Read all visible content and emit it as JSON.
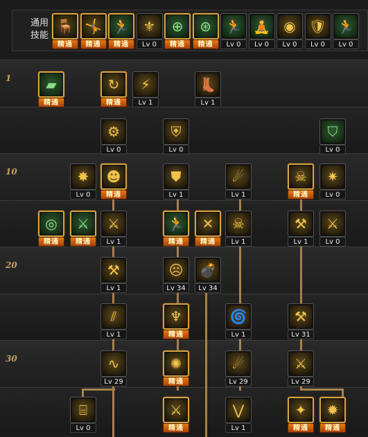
{
  "common": {
    "label": "通用\n技能",
    "skills": [
      {
        "icon": "chair-sit-icon",
        "glyph": "🪑",
        "theme": "yellow",
        "status": "精通"
      },
      {
        "icon": "leap-slash-icon",
        "glyph": "🤸",
        "theme": "yellow",
        "status": "精通"
      },
      {
        "icon": "dash-kick-icon",
        "glyph": "🏃",
        "theme": "green",
        "status": "精通"
      },
      {
        "icon": "winged-emblem-icon",
        "glyph": "⚜",
        "theme": "yellow",
        "status": "Lv 0"
      },
      {
        "icon": "crosshair-icon",
        "glyph": "⊕",
        "theme": "green",
        "status": "精通"
      },
      {
        "icon": "crosshair-ring-icon",
        "glyph": "⊛",
        "theme": "green",
        "status": "精通"
      },
      {
        "icon": "warrior-sprint-icon",
        "glyph": "🏃",
        "theme": "green",
        "status": "Lv 0"
      },
      {
        "icon": "star-meditation-icon",
        "glyph": "🧘",
        "theme": "green",
        "status": "Lv 0"
      },
      {
        "icon": "vision-eye-icon",
        "glyph": "◉",
        "theme": "yellow",
        "status": "Lv 0"
      },
      {
        "icon": "golden-armor-icon",
        "glyph": "🛡",
        "theme": "yellow",
        "status": "Lv 0"
      },
      {
        "icon": "green-runner-icon",
        "glyph": "🏃",
        "theme": "green",
        "status": "Lv 0"
      }
    ]
  },
  "levels": [
    "1",
    "10",
    "20",
    "30"
  ],
  "tree": [
    {
      "icon": "blocks-spear-icon",
      "glyph": "▰",
      "theme": "green",
      "status": "精通"
    },
    {
      "icon": "cycle-arrow-icon",
      "glyph": "↻",
      "theme": "yellow",
      "status": "精通"
    },
    {
      "icon": "lance-thrust-icon",
      "glyph": "⚡",
      "theme": "yellow",
      "status": "Lv 1"
    },
    {
      "icon": "boot-step-icon",
      "glyph": "👢",
      "theme": "yellow",
      "status": "Lv 1"
    },
    {
      "icon": "gear-orb-icon",
      "glyph": "⚙",
      "theme": "yellow",
      "status": "Lv 0"
    },
    {
      "icon": "armor-piece-icon",
      "glyph": "⛨",
      "theme": "yellow",
      "status": "Lv 0"
    },
    {
      "icon": "green-shield-icon",
      "glyph": "⛉",
      "theme": "green",
      "status": "Lv 0"
    },
    {
      "icon": "flame-burst-icon",
      "glyph": "✸",
      "theme": "yellow",
      "status": "Lv 0"
    },
    {
      "icon": "beast-face-icon",
      "glyph": "☻",
      "theme": "yellow",
      "status": "精通"
    },
    {
      "icon": "shield-icon",
      "glyph": "⛊",
      "theme": "yellow",
      "status": "Lv 1"
    },
    {
      "icon": "speed-lines-icon",
      "glyph": "☄",
      "theme": "yellow",
      "status": "Lv 1"
    },
    {
      "icon": "fox-mask-icon",
      "glyph": "☠",
      "theme": "yellow",
      "status": "精通"
    },
    {
      "icon": "shatter-blast-icon",
      "glyph": "✷",
      "theme": "yellow",
      "status": "Lv 0"
    },
    {
      "icon": "green-eye-icon",
      "glyph": "◎",
      "theme": "green",
      "status": "精通"
    },
    {
      "icon": "green-blade-icon",
      "glyph": "⚔",
      "theme": "green",
      "status": "精通"
    },
    {
      "icon": "slash-strike-icon",
      "glyph": "⚔",
      "theme": "yellow",
      "status": "Lv 1"
    },
    {
      "icon": "green-dash-icon",
      "glyph": "🏃",
      "theme": "green",
      "status": "精通"
    },
    {
      "icon": "cross-x-icon",
      "glyph": "✕",
      "theme": "yellow",
      "status": "精通"
    },
    {
      "icon": "skull-blast-icon",
      "glyph": "☠",
      "theme": "yellow",
      "status": "Lv 1"
    },
    {
      "icon": "spin-warrior-icon",
      "glyph": "⚒",
      "theme": "yellow",
      "status": "Lv 1"
    },
    {
      "icon": "crossed-swords-icon",
      "glyph": "⚔",
      "theme": "yellow",
      "status": "Lv 0"
    },
    {
      "icon": "hammer-smash-icon",
      "glyph": "⚒",
      "theme": "yellow",
      "status": "Lv 1"
    },
    {
      "icon": "war-mask-icon",
      "glyph": "☹",
      "theme": "yellow",
      "status": "Lv 34"
    },
    {
      "icon": "bomb-face-icon",
      "glyph": "💣",
      "theme": "yellow",
      "status": "Lv 34"
    },
    {
      "icon": "double-slash-icon",
      "glyph": "⫽",
      "theme": "yellow",
      "status": "Lv 1"
    },
    {
      "icon": "fang-jaw-icon",
      "glyph": "♆",
      "theme": "yellow",
      "status": "精通"
    },
    {
      "icon": "whirlwind-icon",
      "glyph": "🌀",
      "theme": "yellow",
      "status": "Lv 1"
    },
    {
      "icon": "berserker-icon",
      "glyph": "⚒",
      "theme": "yellow",
      "status": "Lv 31"
    },
    {
      "icon": "swirl-slash-icon",
      "glyph": "∿",
      "theme": "yellow",
      "status": "Lv 29"
    },
    {
      "icon": "starburst-icon",
      "glyph": "✺",
      "theme": "yellow",
      "status": "精通"
    },
    {
      "icon": "comet-icon",
      "glyph": "☄",
      "theme": "yellow",
      "status": "Lv 29"
    },
    {
      "icon": "blade-cross-icon",
      "glyph": "⚔",
      "theme": "yellow",
      "status": "Lv 29"
    },
    {
      "icon": "cage-gate-icon",
      "glyph": "⌸",
      "theme": "yellow",
      "status": "Lv 0"
    },
    {
      "icon": "sword-rain-icon",
      "glyph": "⚔",
      "theme": "yellow",
      "status": "精通"
    },
    {
      "icon": "v-strike-icon",
      "glyph": "⋁",
      "theme": "yellow",
      "status": "Lv 1"
    },
    {
      "icon": "fire-warrior-icon",
      "glyph": "✦",
      "theme": "yellow",
      "status": "精通"
    },
    {
      "icon": "star-burst-icon",
      "glyph": "✹",
      "theme": "yellow",
      "status": "精通"
    }
  ]
}
